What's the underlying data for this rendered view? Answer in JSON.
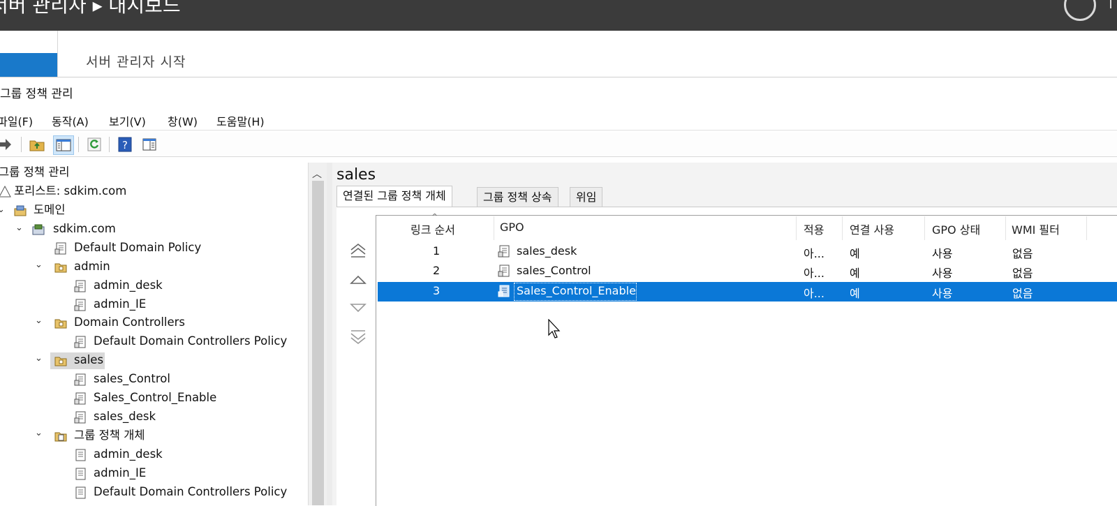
{
  "server_manager": {
    "header_title": "서버 관리자 ▸ 대시보드",
    "welcome_tab": "서버 관리자 시작"
  },
  "window": {
    "title": "그룹 정책 관리"
  },
  "menu": [
    "파일(F)",
    "동작(A)",
    "보기(V)",
    "창(W)",
    "도움말(H)"
  ],
  "toolbar": {
    "icons": [
      "forward-arrow-icon",
      "up-folder-icon",
      "show-hide-tree-icon",
      "refresh-icon",
      "help-icon",
      "properties-icon"
    ]
  },
  "tree": {
    "root": "그룹 정책 관리",
    "forest": "포리스트: sdkim.com",
    "domains": "도메인",
    "domain": "sdkim.com",
    "default_domain_policy": "Default Domain Policy",
    "ou_admin": "admin",
    "admin_desk": "admin_desk",
    "admin_ie": "admin_IE",
    "ou_dc": "Domain Controllers",
    "default_dc_policy": "Default Domain Controllers Policy",
    "ou_sales": "sales",
    "sales_control": "sales_Control",
    "sales_control_enable": "Sales_Control_Enable",
    "sales_desk": "sales_desk",
    "gpo_container": "그룹 정책 개체",
    "gpo_admin_desk": "admin_desk",
    "gpo_admin_ie": "admin_IE",
    "gpo_default_dc": "Default Domain Controllers Policy"
  },
  "details": {
    "title": "sales",
    "tabs": [
      "연결된 그룹 정책 개체",
      "그룹 정책 상속",
      "위임"
    ],
    "columns": [
      "링크 순서",
      "GPO",
      "적용",
      "연결 사용",
      "GPO 상태",
      "WMI 필터"
    ],
    "rows": [
      {
        "order": "1",
        "gpo": "sales_desk",
        "enforced": "아...",
        "link_enabled": "예",
        "status": "사용",
        "wmi": "없음"
      },
      {
        "order": "2",
        "gpo": "sales_Control",
        "enforced": "아...",
        "link_enabled": "예",
        "status": "사용",
        "wmi": "없음"
      },
      {
        "order": "3",
        "gpo": "Sales_Control_Enable",
        "enforced": "아...",
        "link_enabled": "예",
        "status": "사용",
        "wmi": "없음"
      }
    ],
    "selected_row": 3
  },
  "colors": {
    "header_bg": "#3b3b3b",
    "accent_blue": "#1979ca",
    "selection": "#0b78d7"
  }
}
